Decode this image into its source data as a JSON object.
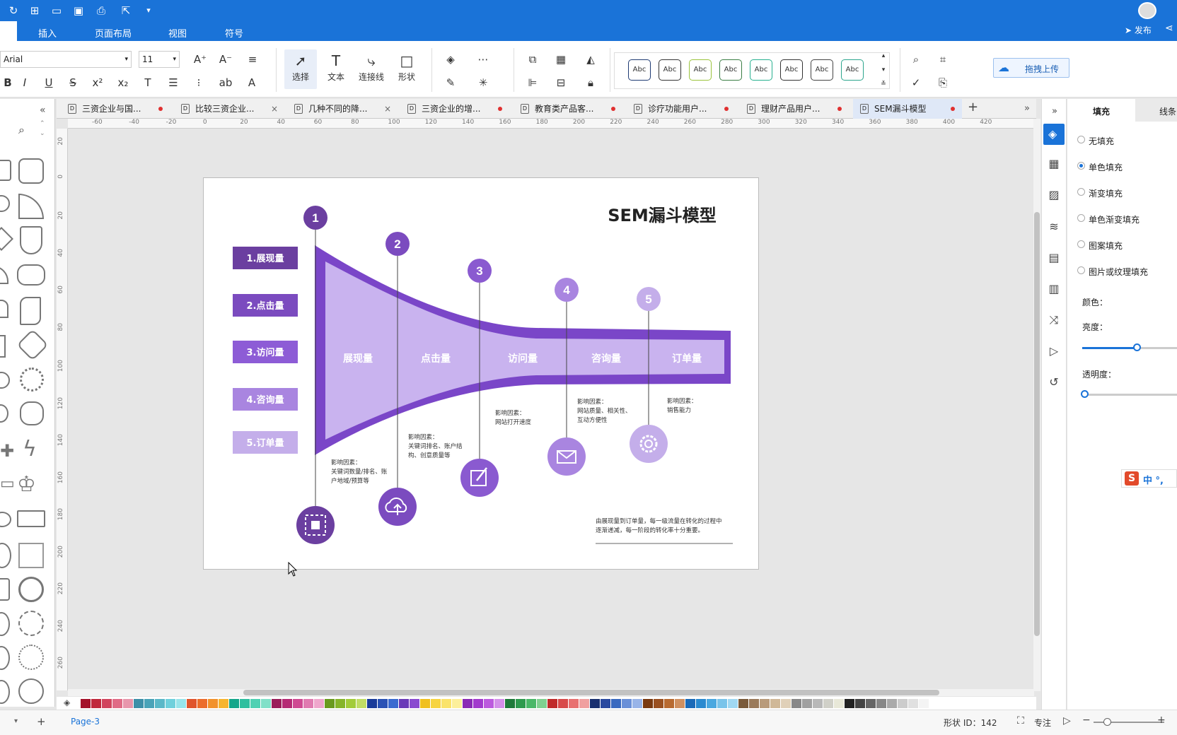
{
  "ribbon_menu": [
    "插入",
    "页面布局",
    "视图",
    "符号"
  ],
  "share": {
    "publish": "发布"
  },
  "toolbar": {
    "font_name": "Arial",
    "font_size": "11",
    "tools": [
      {
        "label": "选择",
        "icon": "pointer-icon"
      },
      {
        "label": "文本",
        "icon": "text-icon"
      },
      {
        "label": "连接线",
        "icon": "connector-icon"
      },
      {
        "label": "形状",
        "icon": "shape-icon"
      }
    ],
    "style_presets": [
      "Abc",
      "Abc",
      "Abc",
      "Abc",
      "Abc",
      "Abc",
      "Abc",
      "Abc"
    ],
    "style_colors": [
      "#1f3b73",
      "#333333",
      "#9ac33c",
      "#3a7d44",
      "#27b08f",
      "#333333",
      "#444444",
      "#2ca58d"
    ],
    "upload": "拖拽上传"
  },
  "doc_tabs": [
    {
      "title": "三资企业与国...",
      "marker": "dot"
    },
    {
      "title": "比较三资企业...",
      "marker": "close"
    },
    {
      "title": "几种不同的降...",
      "marker": "close"
    },
    {
      "title": "三资企业的增...",
      "marker": "dot"
    },
    {
      "title": "教育类产品客...",
      "marker": "dot"
    },
    {
      "title": "诊疗功能用户...",
      "marker": "dot"
    },
    {
      "title": "理财产品用户...",
      "marker": "dot"
    },
    {
      "title": "SEM漏斗模型",
      "marker": "dot",
      "active": true
    }
  ],
  "ruler_top": [
    "-60",
    "-40",
    "-20",
    "0",
    "20",
    "40",
    "60",
    "80",
    "100",
    "120",
    "140",
    "160",
    "180",
    "200",
    "220",
    "240",
    "260",
    "280",
    "300",
    "320",
    "340",
    "360",
    "380",
    "400",
    "420"
  ],
  "ruler_left": [
    "20",
    "0",
    "20",
    "40",
    "60",
    "80",
    "100",
    "120",
    "140",
    "160",
    "180",
    "200",
    "220",
    "240",
    "260"
  ],
  "diagram": {
    "title": "SEM漏斗模型",
    "stages": [
      {
        "num": "1",
        "label": "1.展现量",
        "funnel_label": "展现量",
        "color": "#6b3fa0",
        "factors": [
          "影响因素：",
          "关键词数量/排名、账",
          "户地域/预算等"
        ],
        "icon": "qr-icon"
      },
      {
        "num": "2",
        "label": "2.点击量",
        "funnel_label": "点击量",
        "color": "#7b4bbf",
        "factors": [
          "影响因素：",
          "关键词排名、账户结",
          "构、创意质量等"
        ],
        "icon": "cloud-upload-icon"
      },
      {
        "num": "3",
        "label": "3.访问量",
        "funnel_label": "访问量",
        "color": "#8d5cd6",
        "factors": [
          "影响因素：",
          "网站打开速度"
        ],
        "icon": "edit-icon"
      },
      {
        "num": "4",
        "label": "4.咨询量",
        "funnel_label": "咨询量",
        "color": "#a985e0",
        "factors": [
          "影响因素：",
          "网站质量、相关性、",
          "互动方便性"
        ],
        "icon": "mail-icon"
      },
      {
        "num": "5",
        "label": "5.订单量",
        "funnel_label": "订单量",
        "color": "#c4aeea",
        "factors": [
          "影响因素：",
          "销售能力"
        ],
        "icon": "gear-icon"
      }
    ],
    "note": [
      "由展现量到订单量，每一级流量在转化的过程中",
      "逐渐递减，每一阶段的转化率十分重要。"
    ]
  },
  "palette": [
    "#a4122a",
    "#c0283c",
    "#d1455e",
    "#e06b86",
    "#e896ac",
    "#3e8fa8",
    "#4aa3b8",
    "#5ab8c8",
    "#6fd0dc",
    "#98e4ea",
    "#e0552c",
    "#ec6e2c",
    "#f2922c",
    "#f7b52f",
    "#14a68a",
    "#2fbf9f",
    "#4fd1b3",
    "#80e0c8",
    "#9a1e5a",
    "#b52a74",
    "#cf4a92",
    "#e07ab0",
    "#efa6cc",
    "#6a9a1e",
    "#86b52a",
    "#a2cc3a",
    "#c0dd66",
    "#1a3c9a",
    "#2a52b5",
    "#3a6ad0",
    "#6a3ab8",
    "#8a4ad0",
    "#f0c020",
    "#f7d440",
    "#fae36a",
    "#fcef9a",
    "#8a2ab5",
    "#a23acd",
    "#bc5ade",
    "#d490ea",
    "#1e7a3a",
    "#2e9a4e",
    "#4ab868",
    "#80d090",
    "#c02a2a",
    "#d84a4a",
    "#e87070",
    "#f0a0a0",
    "#1a3070",
    "#2a4aa0",
    "#3a6ac0",
    "#6a90d8",
    "#98b4e8",
    "#7a3a10",
    "#9a5020",
    "#b86a30",
    "#d09060",
    "#1a6ab8",
    "#2a8ad0",
    "#4aa8e0",
    "#7ac4ea",
    "#a0d8f2",
    "#7a5a3a",
    "#9a7a5a",
    "#b89a7a",
    "#d0b898",
    "#e0d0b8",
    "#888888",
    "#a0a0a0",
    "#b8b8b8",
    "#d0d0c8",
    "#e8e8d8",
    "#222222",
    "#444444",
    "#666666",
    "#888888",
    "#aaaaaa",
    "#cccccc",
    "#e0e0e0",
    "#f4f4f4"
  ],
  "status": {
    "page": "Page-3",
    "shape_id": "形状 ID：142",
    "focus": "专注"
  },
  "right_panel": {
    "tabs": [
      "填充",
      "线条"
    ],
    "fill_options": [
      {
        "label": "无填充",
        "selected": false
      },
      {
        "label": "单色填充",
        "selected": true
      },
      {
        "label": "渐变填充",
        "selected": false
      },
      {
        "label": "单色渐变填充",
        "selected": false
      },
      {
        "label": "图案填充",
        "selected": false
      },
      {
        "label": "图片或纹理填充",
        "selected": false
      }
    ],
    "color_label": "颜色：",
    "brightness_label": "亮度：",
    "brightness": 0.58,
    "transparency_label": "透明度：",
    "transparency": 0.0
  },
  "ime": {
    "text": "中 °,"
  }
}
